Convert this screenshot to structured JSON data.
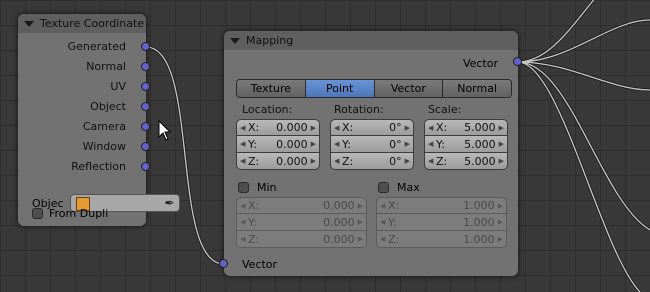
{
  "texture_coordinate_node": {
    "title": "Texture Coordinate",
    "outputs": [
      "Generated",
      "Normal",
      "UV",
      "Object",
      "Camera",
      "Window",
      "Reflection"
    ],
    "object_label": "Objec",
    "from_dupli_label": "From Dupli",
    "from_dupli_checked": false
  },
  "mapping_node": {
    "title": "Mapping",
    "output_label": "Vector",
    "input_label": "Vector",
    "tabs": [
      "Texture",
      "Point",
      "Vector",
      "Normal"
    ],
    "active_tab": "Point",
    "location": {
      "label": "Location:",
      "x": "0.000",
      "y": "0.000",
      "z": "0.000"
    },
    "rotation": {
      "label": "Rotation:",
      "x": "0°",
      "y": "0°",
      "z": "0°"
    },
    "scale": {
      "label": "Scale:",
      "x": "5.000",
      "y": "5.000",
      "z": "5.000"
    },
    "min": {
      "label": "Min",
      "checked": false,
      "x": "0.000",
      "y": "0.000",
      "z": "0.000"
    },
    "max": {
      "label": "Max",
      "checked": false,
      "x": "1.000",
      "y": "1.000",
      "z": "1.000"
    },
    "axis_labels": {
      "x": "X:",
      "y": "Y:",
      "z": "Z:"
    }
  },
  "colors": {
    "socket_vector": "#6363c7",
    "active_tab": "#5680c2",
    "background": "#393939",
    "node_body": "#727272"
  }
}
